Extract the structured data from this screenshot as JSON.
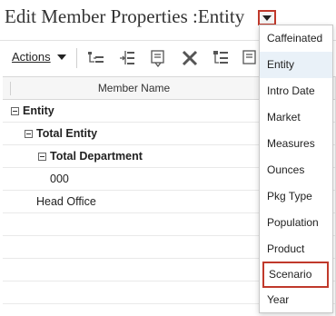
{
  "page": {
    "title": "Edit Member Properties :Entity"
  },
  "toolbar": {
    "actions_label": "Actions",
    "icons": [
      "add-child-icon",
      "add-sibling-icon",
      "edit-member-icon",
      "delete-icon",
      "move-icon",
      "properties-icon"
    ]
  },
  "grid": {
    "column_header": "Member Name",
    "rows": [
      {
        "label": "Entity",
        "bold": true,
        "collapsible": true
      },
      {
        "label": "Total Entity",
        "bold": true,
        "collapsible": true
      },
      {
        "label": "Total Department",
        "bold": true,
        "collapsible": true
      },
      {
        "label": "000",
        "bold": false,
        "collapsible": false
      },
      {
        "label": "Head Office",
        "bold": false,
        "collapsible": false
      }
    ]
  },
  "dimension_menu": {
    "items": [
      "Caffeinated",
      "Entity",
      "Intro Date",
      "Market",
      "Measures",
      "Ounces",
      "Pkg Type",
      "Population",
      "Product",
      "Scenario",
      "Year"
    ],
    "selected": "Entity",
    "highlighted": "Scenario"
  },
  "colors": {
    "highlight_border": "#c0392b",
    "selected_bg": "#e9f1f8"
  }
}
